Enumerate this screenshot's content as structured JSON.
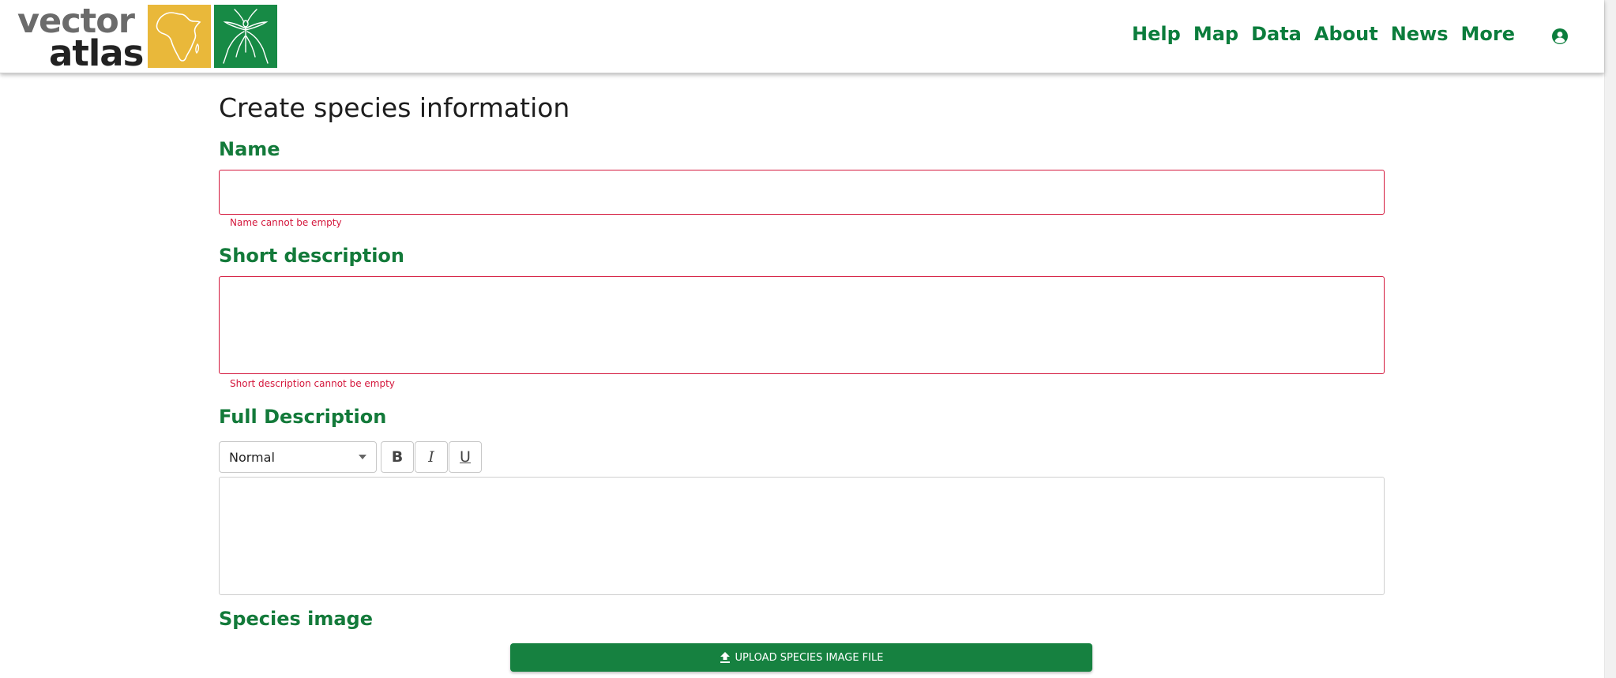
{
  "brand": {
    "line1": "vector",
    "line2": "atlas"
  },
  "nav": {
    "items": [
      "Help",
      "Map",
      "Data",
      "About",
      "News",
      "More"
    ]
  },
  "page": {
    "title": "Create species information"
  },
  "form": {
    "name": {
      "label": "Name",
      "value": "",
      "error": "Name cannot be empty"
    },
    "short_description": {
      "label": "Short description",
      "value": "",
      "error": "Short description cannot be empty"
    },
    "full_description": {
      "label": "Full Description",
      "format_selected": "Normal",
      "toolbar": {
        "bold": "B",
        "italic": "I",
        "underline": "U"
      }
    },
    "species_image": {
      "label": "Species image",
      "upload_label": "UPLOAD SPECIES IMAGE FILE"
    }
  },
  "colors": {
    "brand_green": "#178a45",
    "accent_yellow": "#e9b83a",
    "error_red": "#d4173c",
    "link_green": "#0b7d3c"
  }
}
